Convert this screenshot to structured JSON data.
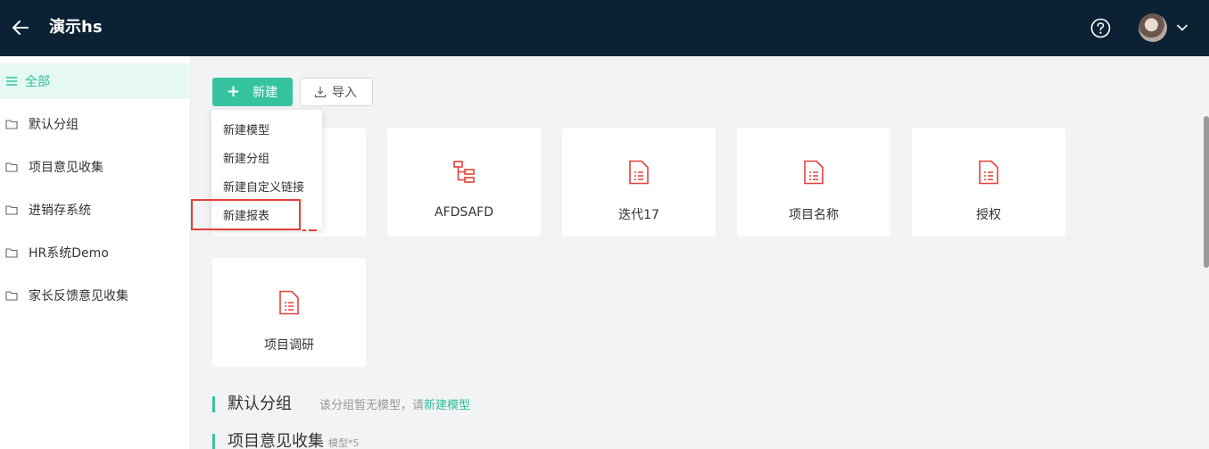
{
  "header": {
    "title": "演示hs",
    "back_icon": "arrow-left-icon",
    "help_icon": "question-circle-icon",
    "avatar_icon": "user-avatar",
    "dropdown_icon": "chevron-down-icon"
  },
  "sidebar": {
    "items": [
      {
        "label": "全部",
        "icon": "list-icon",
        "active": true
      },
      {
        "label": "默认分组",
        "icon": "folder-icon"
      },
      {
        "label": "项目意见收集",
        "icon": "folder-icon"
      },
      {
        "label": "进销存系统",
        "icon": "folder-icon"
      },
      {
        "label": "HR系统Demo",
        "icon": "folder-icon"
      },
      {
        "label": "家长反馈意见收集",
        "icon": "folder-icon"
      }
    ]
  },
  "toolbar": {
    "new_label": "新建",
    "new_icon": "plus-icon",
    "import_label": "导入",
    "import_icon": "download-icon"
  },
  "dropdown": {
    "items": [
      "新建模型",
      "新建分组",
      "新建自定义链接",
      "新建报表"
    ]
  },
  "cards": [
    {
      "name": "AFDSAFD",
      "icon": "tree-structure-icon"
    },
    {
      "name": "迭代17",
      "icon": "document-icon"
    },
    {
      "name": "项目名称",
      "icon": "document-icon"
    },
    {
      "name": "授权",
      "icon": "document-icon"
    },
    {
      "name": "项目调研",
      "icon": "document-icon"
    }
  ],
  "sections": [
    {
      "title": "默认分组",
      "desc_prefix": "该分组暂无模型，请",
      "desc_link": "新建模型"
    },
    {
      "title": "项目意见收集",
      "count": "模型*5"
    }
  ],
  "colors": {
    "header_bg": "#0a2233",
    "accent": "#36c4a0",
    "icon_red": "#e5403a",
    "highlight_box": "#e5403a"
  }
}
